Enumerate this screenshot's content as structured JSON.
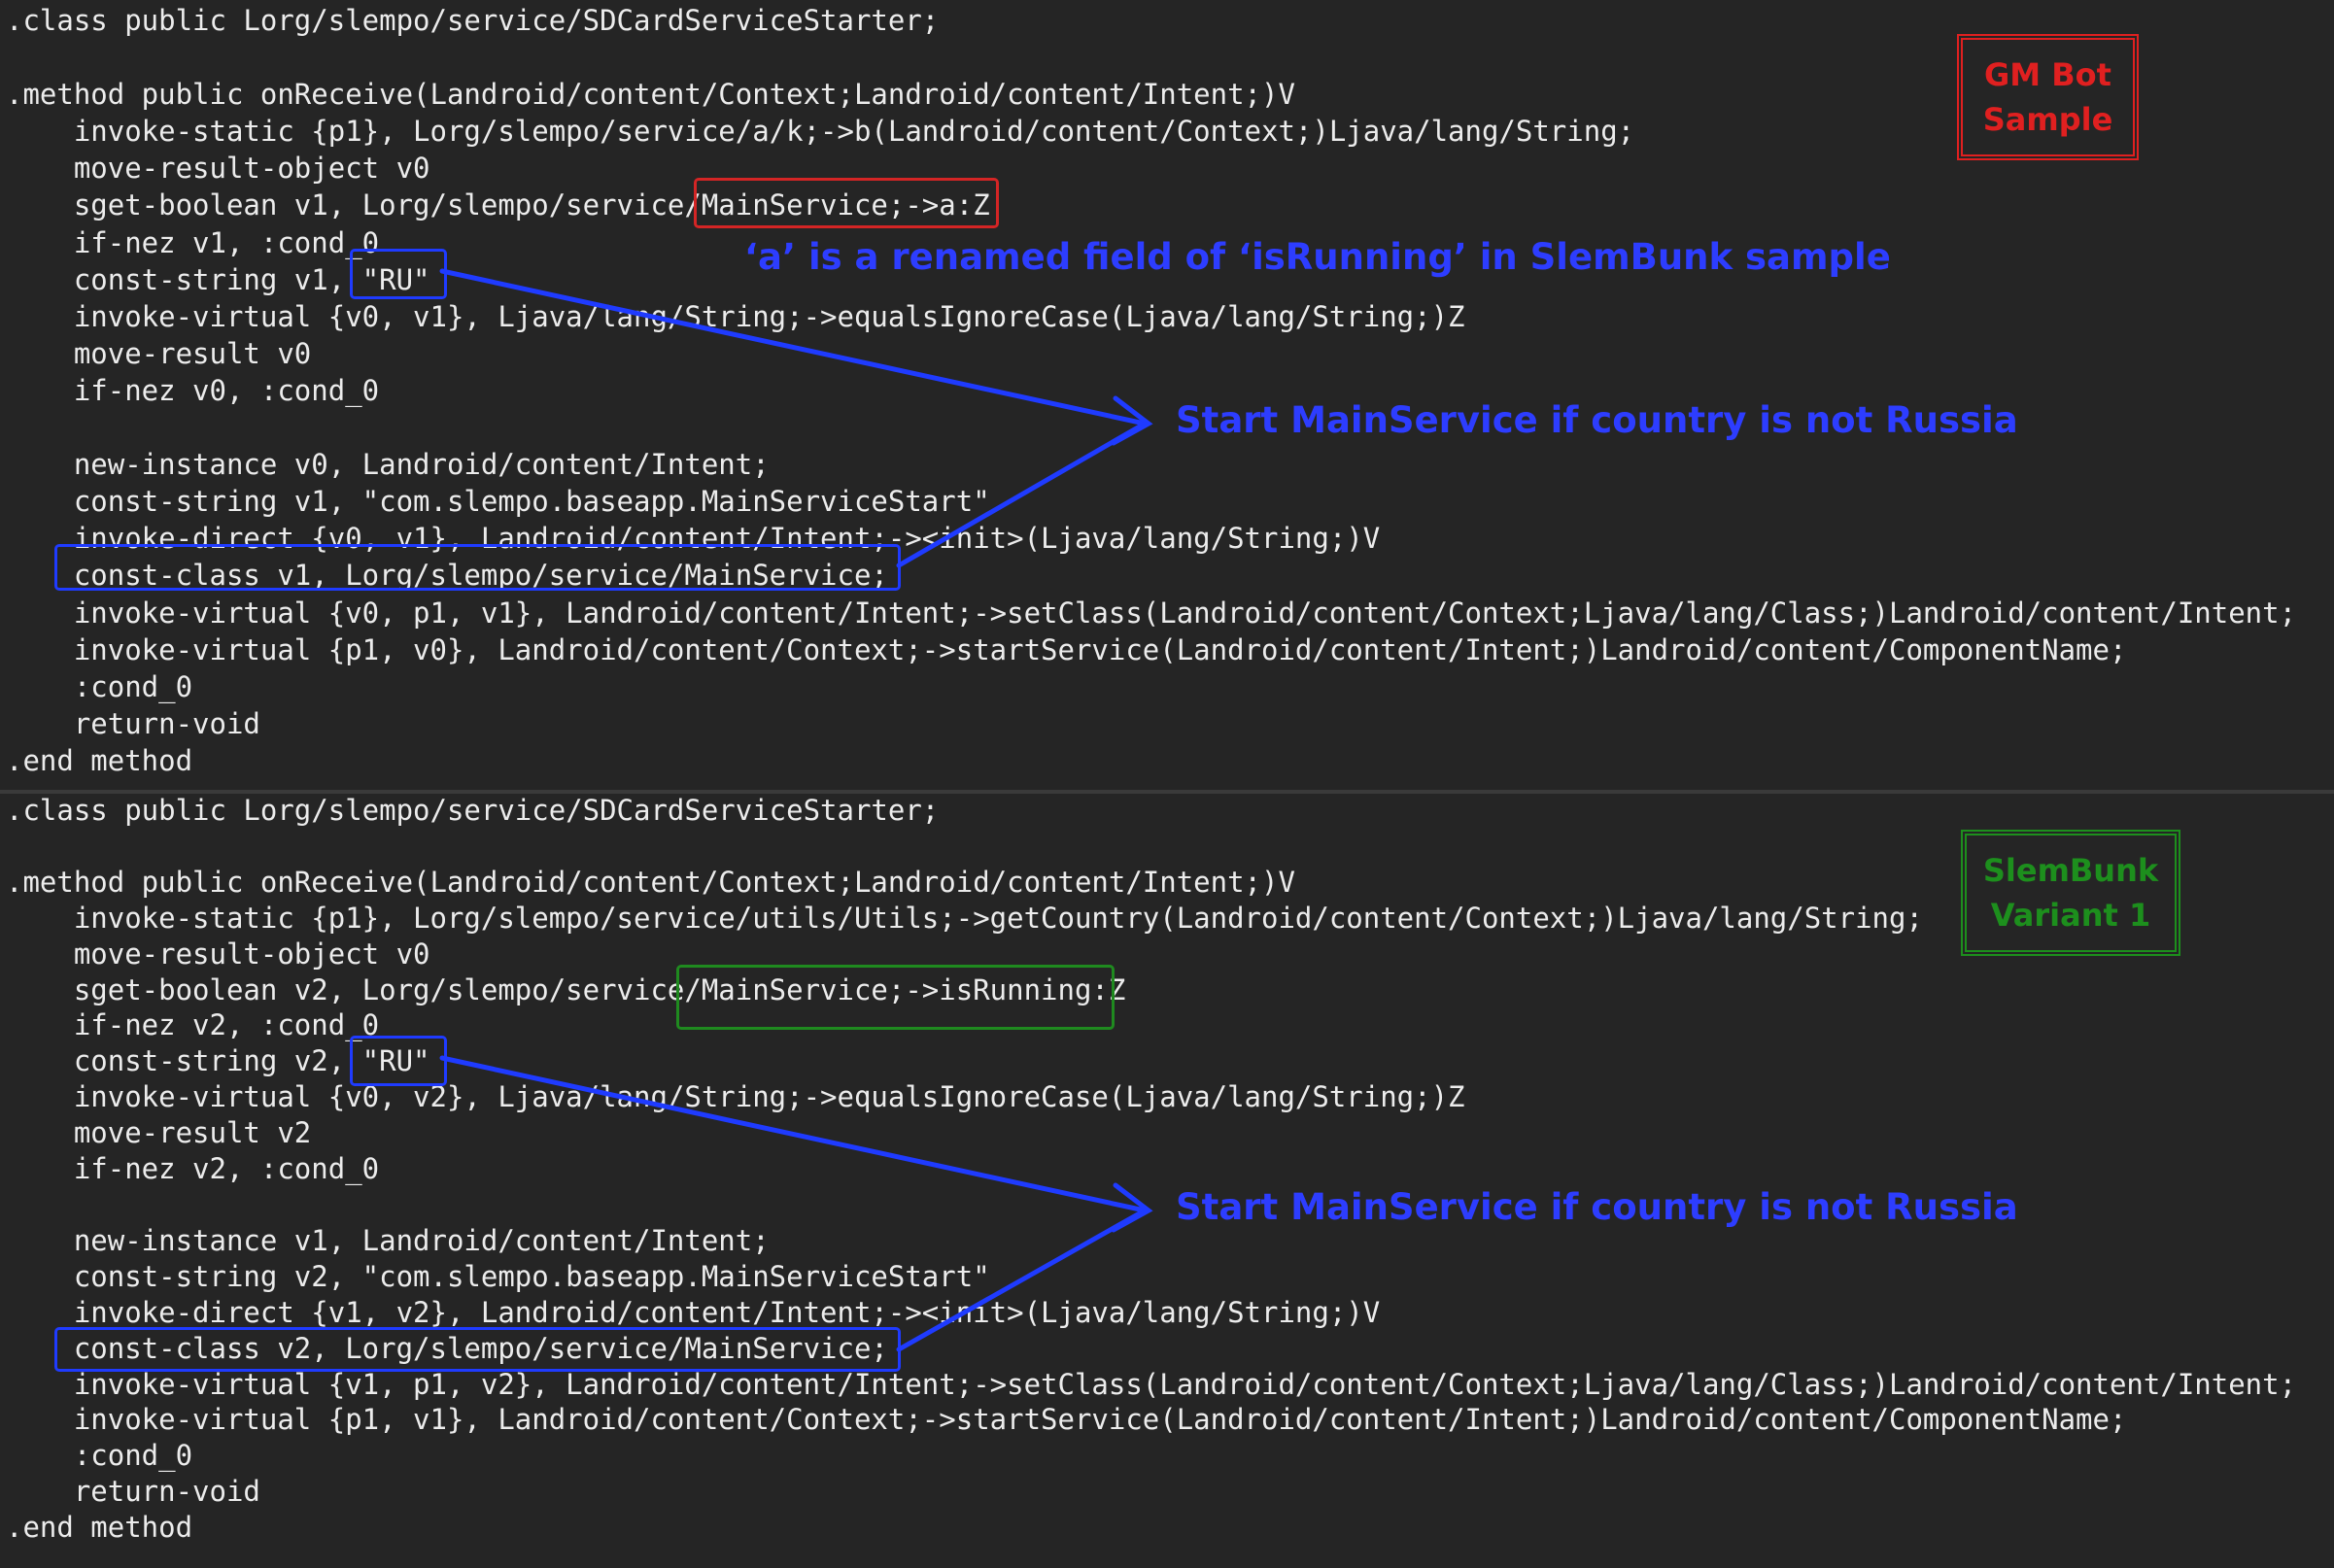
{
  "top": {
    "code_lines": [
      ".class public Lorg/slempo/service/SDCardServiceStarter;",
      "",
      ".method public onReceive(Landroid/content/Context;Landroid/content/Intent;)V",
      "    invoke-static {p1}, Lorg/slempo/service/a/k;->b(Landroid/content/Context;)Ljava/lang/String;",
      "    move-result-object v0",
      "    sget-boolean v1, Lorg/slempo/service/MainService;->a:Z",
      "    if-nez v1, :cond_0",
      "    const-string v1, \"RU\"",
      "    invoke-virtual {v0, v1}, Ljava/lang/String;->equalsIgnoreCase(Ljava/lang/String;)Z",
      "    move-result v0",
      "    if-nez v0, :cond_0",
      "",
      "    new-instance v0, Landroid/content/Intent;",
      "    const-string v1, \"com.slempo.baseapp.MainServiceStart\"",
      "    invoke-direct {v0, v1}, Landroid/content/Intent;-><init>(Ljava/lang/String;)V",
      "    const-class v1, Lorg/slempo/service/MainService;",
      "    invoke-virtual {v0, p1, v1}, Landroid/content/Intent;->setClass(Landroid/content/Context;Ljava/lang/Class;)Landroid/content/Intent;",
      "    invoke-virtual {p1, v0}, Landroid/content/Context;->startService(Landroid/content/Intent;)Landroid/content/ComponentName;",
      "    :cond_0",
      "    return-void",
      ".end method"
    ],
    "sample_label_line1": "GM Bot",
    "sample_label_line2": "Sample",
    "rename_note": "‘a’ is a renamed field of ‘isRunning’ in SlemBunk sample",
    "arrow_note": "Start MainService if country is not Russia"
  },
  "bottom": {
    "code_lines": [
      ".class public Lorg/slempo/service/SDCardServiceStarter;",
      "",
      ".method public onReceive(Landroid/content/Context;Landroid/content/Intent;)V",
      "    invoke-static {p1}, Lorg/slempo/service/utils/Utils;->getCountry(Landroid/content/Context;)Ljava/lang/String;",
      "    move-result-object v0",
      "    sget-boolean v2, Lorg/slempo/service/MainService;->isRunning:Z",
      "    if-nez v2, :cond_0",
      "    const-string v2, \"RU\"",
      "    invoke-virtual {v0, v2}, Ljava/lang/String;->equalsIgnoreCase(Ljava/lang/String;)Z",
      "    move-result v2",
      "    if-nez v2, :cond_0",
      "",
      "    new-instance v1, Landroid/content/Intent;",
      "    const-string v2, \"com.slempo.baseapp.MainServiceStart\"",
      "    invoke-direct {v1, v2}, Landroid/content/Intent;-><init>(Ljava/lang/String;)V",
      "    const-class v2, Lorg/slempo/service/MainService;",
      "    invoke-virtual {v1, p1, v2}, Landroid/content/Intent;->setClass(Landroid/content/Context;Ljava/lang/Class;)Landroid/content/Intent;",
      "    invoke-virtual {p1, v1}, Landroid/content/Context;->startService(Landroid/content/Intent;)Landroid/content/ComponentName;",
      "    :cond_0",
      "    return-void",
      ".end method"
    ],
    "sample_label_line1": "SlemBunk",
    "sample_label_line2": "Variant 1",
    "arrow_note": "Start MainService if country is not Russia"
  },
  "colors": {
    "background": "#252525",
    "code_text": "#ececec",
    "annotation_blue": "#2d3dff",
    "gm_bot_red": "#e02020",
    "slembunk_green": "#1d8f1d"
  }
}
